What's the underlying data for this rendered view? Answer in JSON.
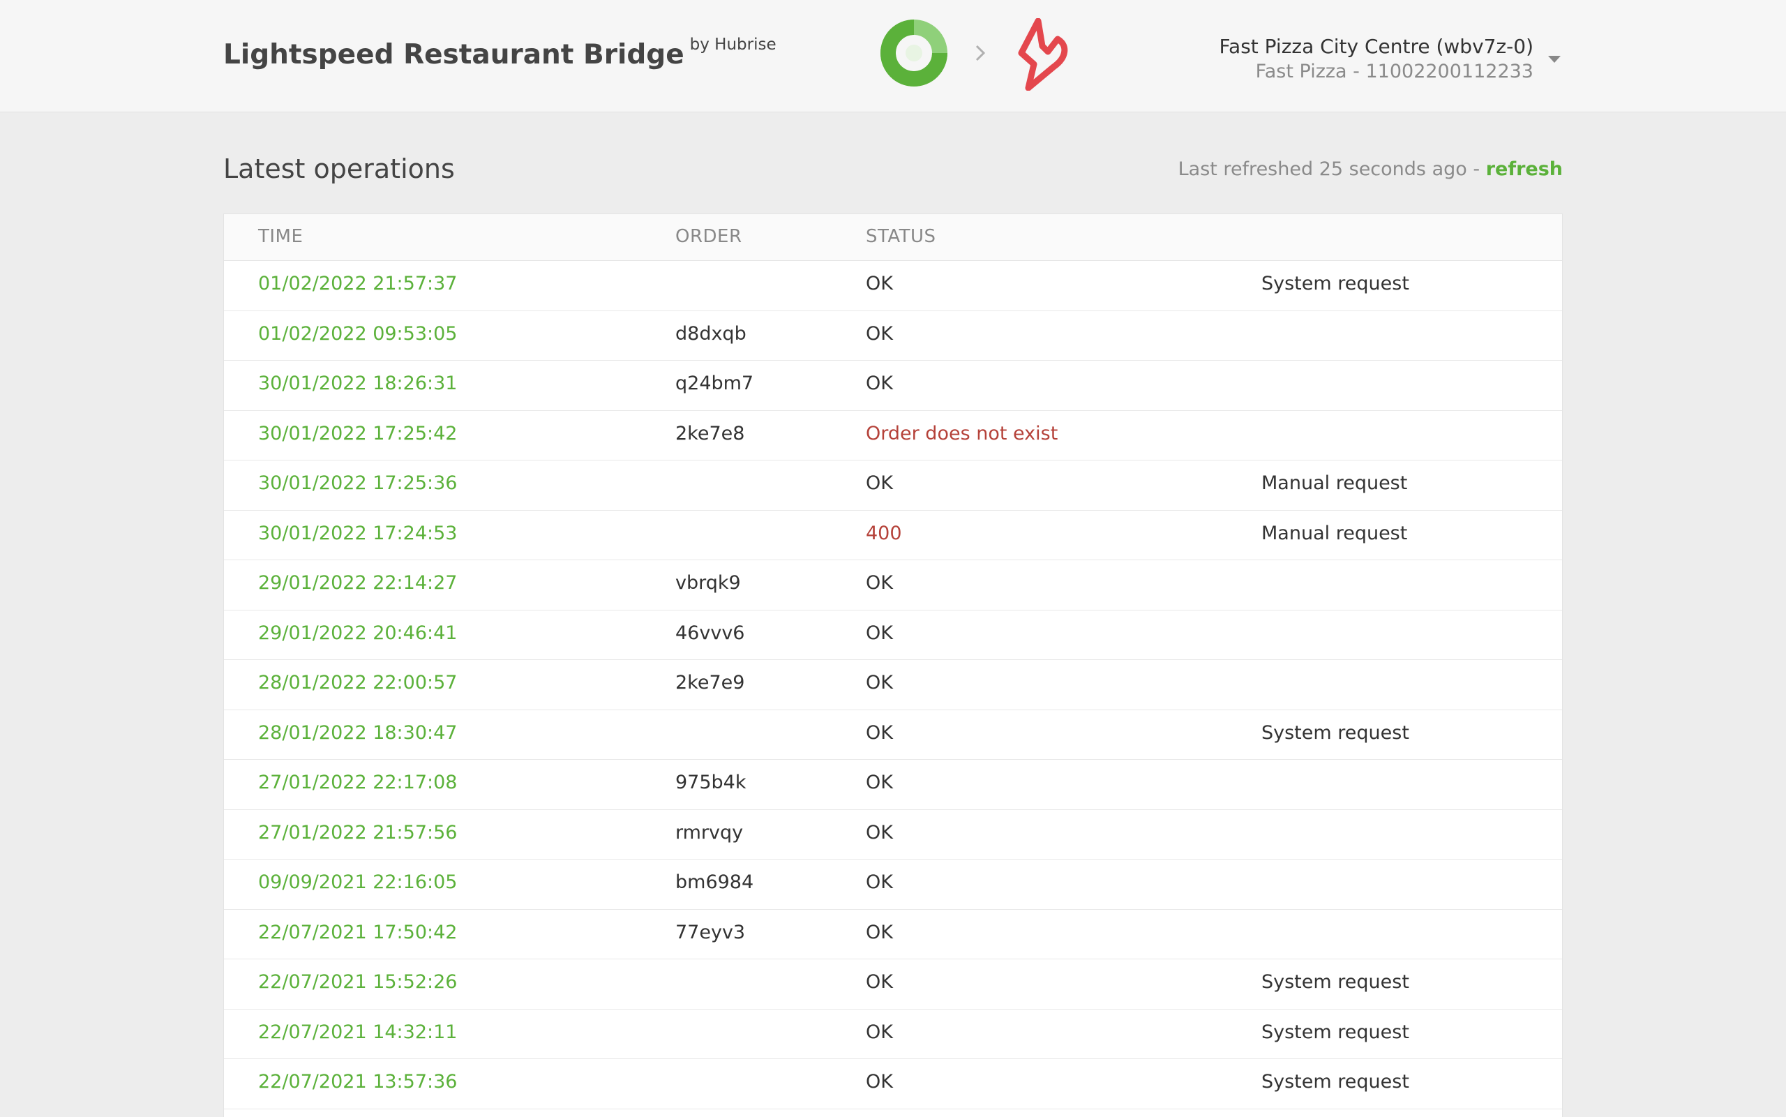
{
  "header": {
    "title": "Lightspeed Restaurant Bridge",
    "by": "by Hubrise",
    "account_name": "Fast Pizza City Centre (wbv7z-0)",
    "account_sub": "Fast Pizza - 11002200112233"
  },
  "main": {
    "section_title": "Latest operations",
    "refresh_text": "Last refreshed 25 seconds ago -",
    "refresh_link": "refresh"
  },
  "table": {
    "columns": [
      "TIME",
      "ORDER",
      "STATUS"
    ],
    "rows": [
      {
        "time": "01/02/2022 21:57:37",
        "order": "",
        "status": "OK",
        "note": "System request"
      },
      {
        "time": "01/02/2022 09:53:05",
        "order": "d8dxqb",
        "status": "OK",
        "note": ""
      },
      {
        "time": "30/01/2022 18:26:31",
        "order": "q24bm7",
        "status": "OK",
        "note": ""
      },
      {
        "time": "30/01/2022 17:25:42",
        "order": "2ke7e8",
        "status": "Order does not exist",
        "note": ""
      },
      {
        "time": "30/01/2022 17:25:36",
        "order": "",
        "status": "OK",
        "note": "Manual request"
      },
      {
        "time": "30/01/2022 17:24:53",
        "order": "",
        "status": "400",
        "note": "Manual request"
      },
      {
        "time": "29/01/2022 22:14:27",
        "order": "vbrqk9",
        "status": "OK",
        "note": ""
      },
      {
        "time": "29/01/2022 20:46:41",
        "order": "46vvv6",
        "status": "OK",
        "note": ""
      },
      {
        "time": "28/01/2022 22:00:57",
        "order": "2ke7e9",
        "status": "OK",
        "note": ""
      },
      {
        "time": "28/01/2022 18:30:47",
        "order": "",
        "status": "OK",
        "note": "System request"
      },
      {
        "time": "27/01/2022 22:17:08",
        "order": "975b4k",
        "status": "OK",
        "note": ""
      },
      {
        "time": "27/01/2022 21:57:56",
        "order": "rmrvqy",
        "status": "OK",
        "note": ""
      },
      {
        "time": "09/09/2021 22:16:05",
        "order": "bm6984",
        "status": "OK",
        "note": ""
      },
      {
        "time": "22/07/2021 17:50:42",
        "order": "77eyv3",
        "status": "OK",
        "note": ""
      },
      {
        "time": "22/07/2021 15:52:26",
        "order": "",
        "status": "OK",
        "note": "System request"
      },
      {
        "time": "22/07/2021 14:32:11",
        "order": "",
        "status": "OK",
        "note": "System request"
      },
      {
        "time": "22/07/2021 13:57:36",
        "order": "",
        "status": "OK",
        "note": "System request"
      }
    ]
  },
  "colors": {
    "accent_green": "#5bb13a",
    "error_red": "#b5423a",
    "lightspeed_red": "#e4474d"
  },
  "icons": {
    "hubrise_logo": "hubrise-logo-icon",
    "arrow": "chevron-right-icon",
    "lightspeed_logo": "lightspeed-logo-icon",
    "caret": "caret-down-icon"
  }
}
